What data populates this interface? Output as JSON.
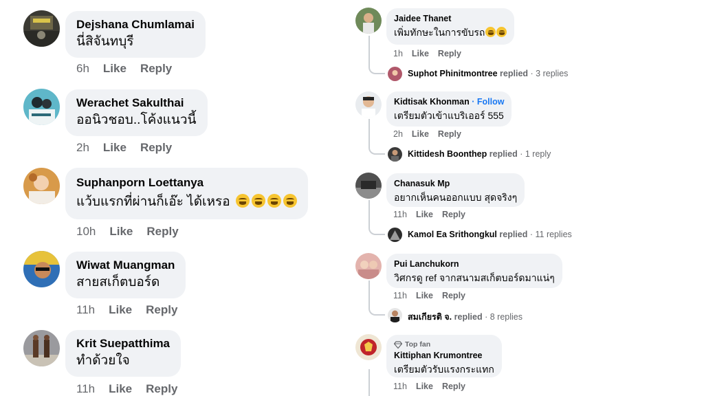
{
  "left_comments": [
    {
      "name": "Dejshana Chumlamai",
      "text": "นี่สิจันทบุรี",
      "emojis": 0,
      "time": "6h",
      "like": "Like",
      "reply": "Reply"
    },
    {
      "name": "Werachet Sakulthai",
      "text": "ออนิวชอบ..โค้งแนวนี้",
      "emojis": 0,
      "time": "2h",
      "like": "Like",
      "reply": "Reply"
    },
    {
      "name": "Suphanporn Loettanya",
      "text": "แว้บแรกที่ผ่านก็เอ๊ะ ได้เหรอ",
      "emojis": 4,
      "emoji_icon": "rofl-emoji",
      "time": "10h",
      "like": "Like",
      "reply": "Reply"
    },
    {
      "name": "Wiwat Muangman",
      "text": "สายสเก็ตบอร์ด",
      "emojis": 0,
      "time": "11h",
      "like": "Like",
      "reply": "Reply"
    },
    {
      "name": "Krit Suepatthima",
      "text": "ทำด้วยใจ",
      "emojis": 0,
      "time": "11h",
      "like": "Like",
      "reply": "Reply"
    }
  ],
  "right_comments": [
    {
      "name": "Jaidee Thanet",
      "follow": "",
      "top_fan": "",
      "text": "เพิ่มทักษะในการขับรถ",
      "emojis": 2,
      "emoji_icon": "grin-emoji",
      "time": "1h",
      "like": "Like",
      "reply": "Reply",
      "replier": "Suphot Phinitmontree",
      "replied_word": "replied",
      "reply_count": "· 3 replies"
    },
    {
      "name": "Kidtisak Khonman",
      "follow": "· Follow",
      "top_fan": "",
      "text": "เตรียมตัวเข้าแบริเออร์ 555",
      "emojis": 0,
      "time": "2h",
      "like": "Like",
      "reply": "Reply",
      "replier": "Kittidesh Boonthep",
      "replied_word": "replied",
      "reply_count": "· 1 reply"
    },
    {
      "name": "Chanasuk Mp",
      "follow": "",
      "top_fan": "",
      "text": "อยากเห็นคนออกแบบ สุดจริงๆ",
      "emojis": 0,
      "time": "11h",
      "like": "Like",
      "reply": "Reply",
      "replier": "Kamol Ea Srithongkul",
      "replied_word": "replied",
      "reply_count": "· 11 replies"
    },
    {
      "name": "Pui Lanchukorn",
      "follow": "",
      "top_fan": "",
      "text": "วิศกรดู ref จากสนามสเก็ตบอร์ดมาแน่ๆ",
      "emojis": 0,
      "time": "11h",
      "like": "Like",
      "reply": "Reply",
      "replier": "สมเกียรติ จ.",
      "replied_word": "replied",
      "reply_count": "· 8 replies"
    },
    {
      "name": "Kittiphan Krumontree",
      "follow": "",
      "top_fan": "Top fan",
      "top_fan_icon": "diamond-badge-icon",
      "text": "เตรียมตัวรับแรงกระแทก",
      "emojis": 0,
      "time": "11h",
      "like": "Like",
      "reply": "Reply"
    }
  ],
  "colors": {
    "bubble": "#f0f2f5",
    "meta_text": "#65676b",
    "follow": "#1877f2",
    "thread_line": "#ccd0d5",
    "emoji": "#f7c531"
  }
}
